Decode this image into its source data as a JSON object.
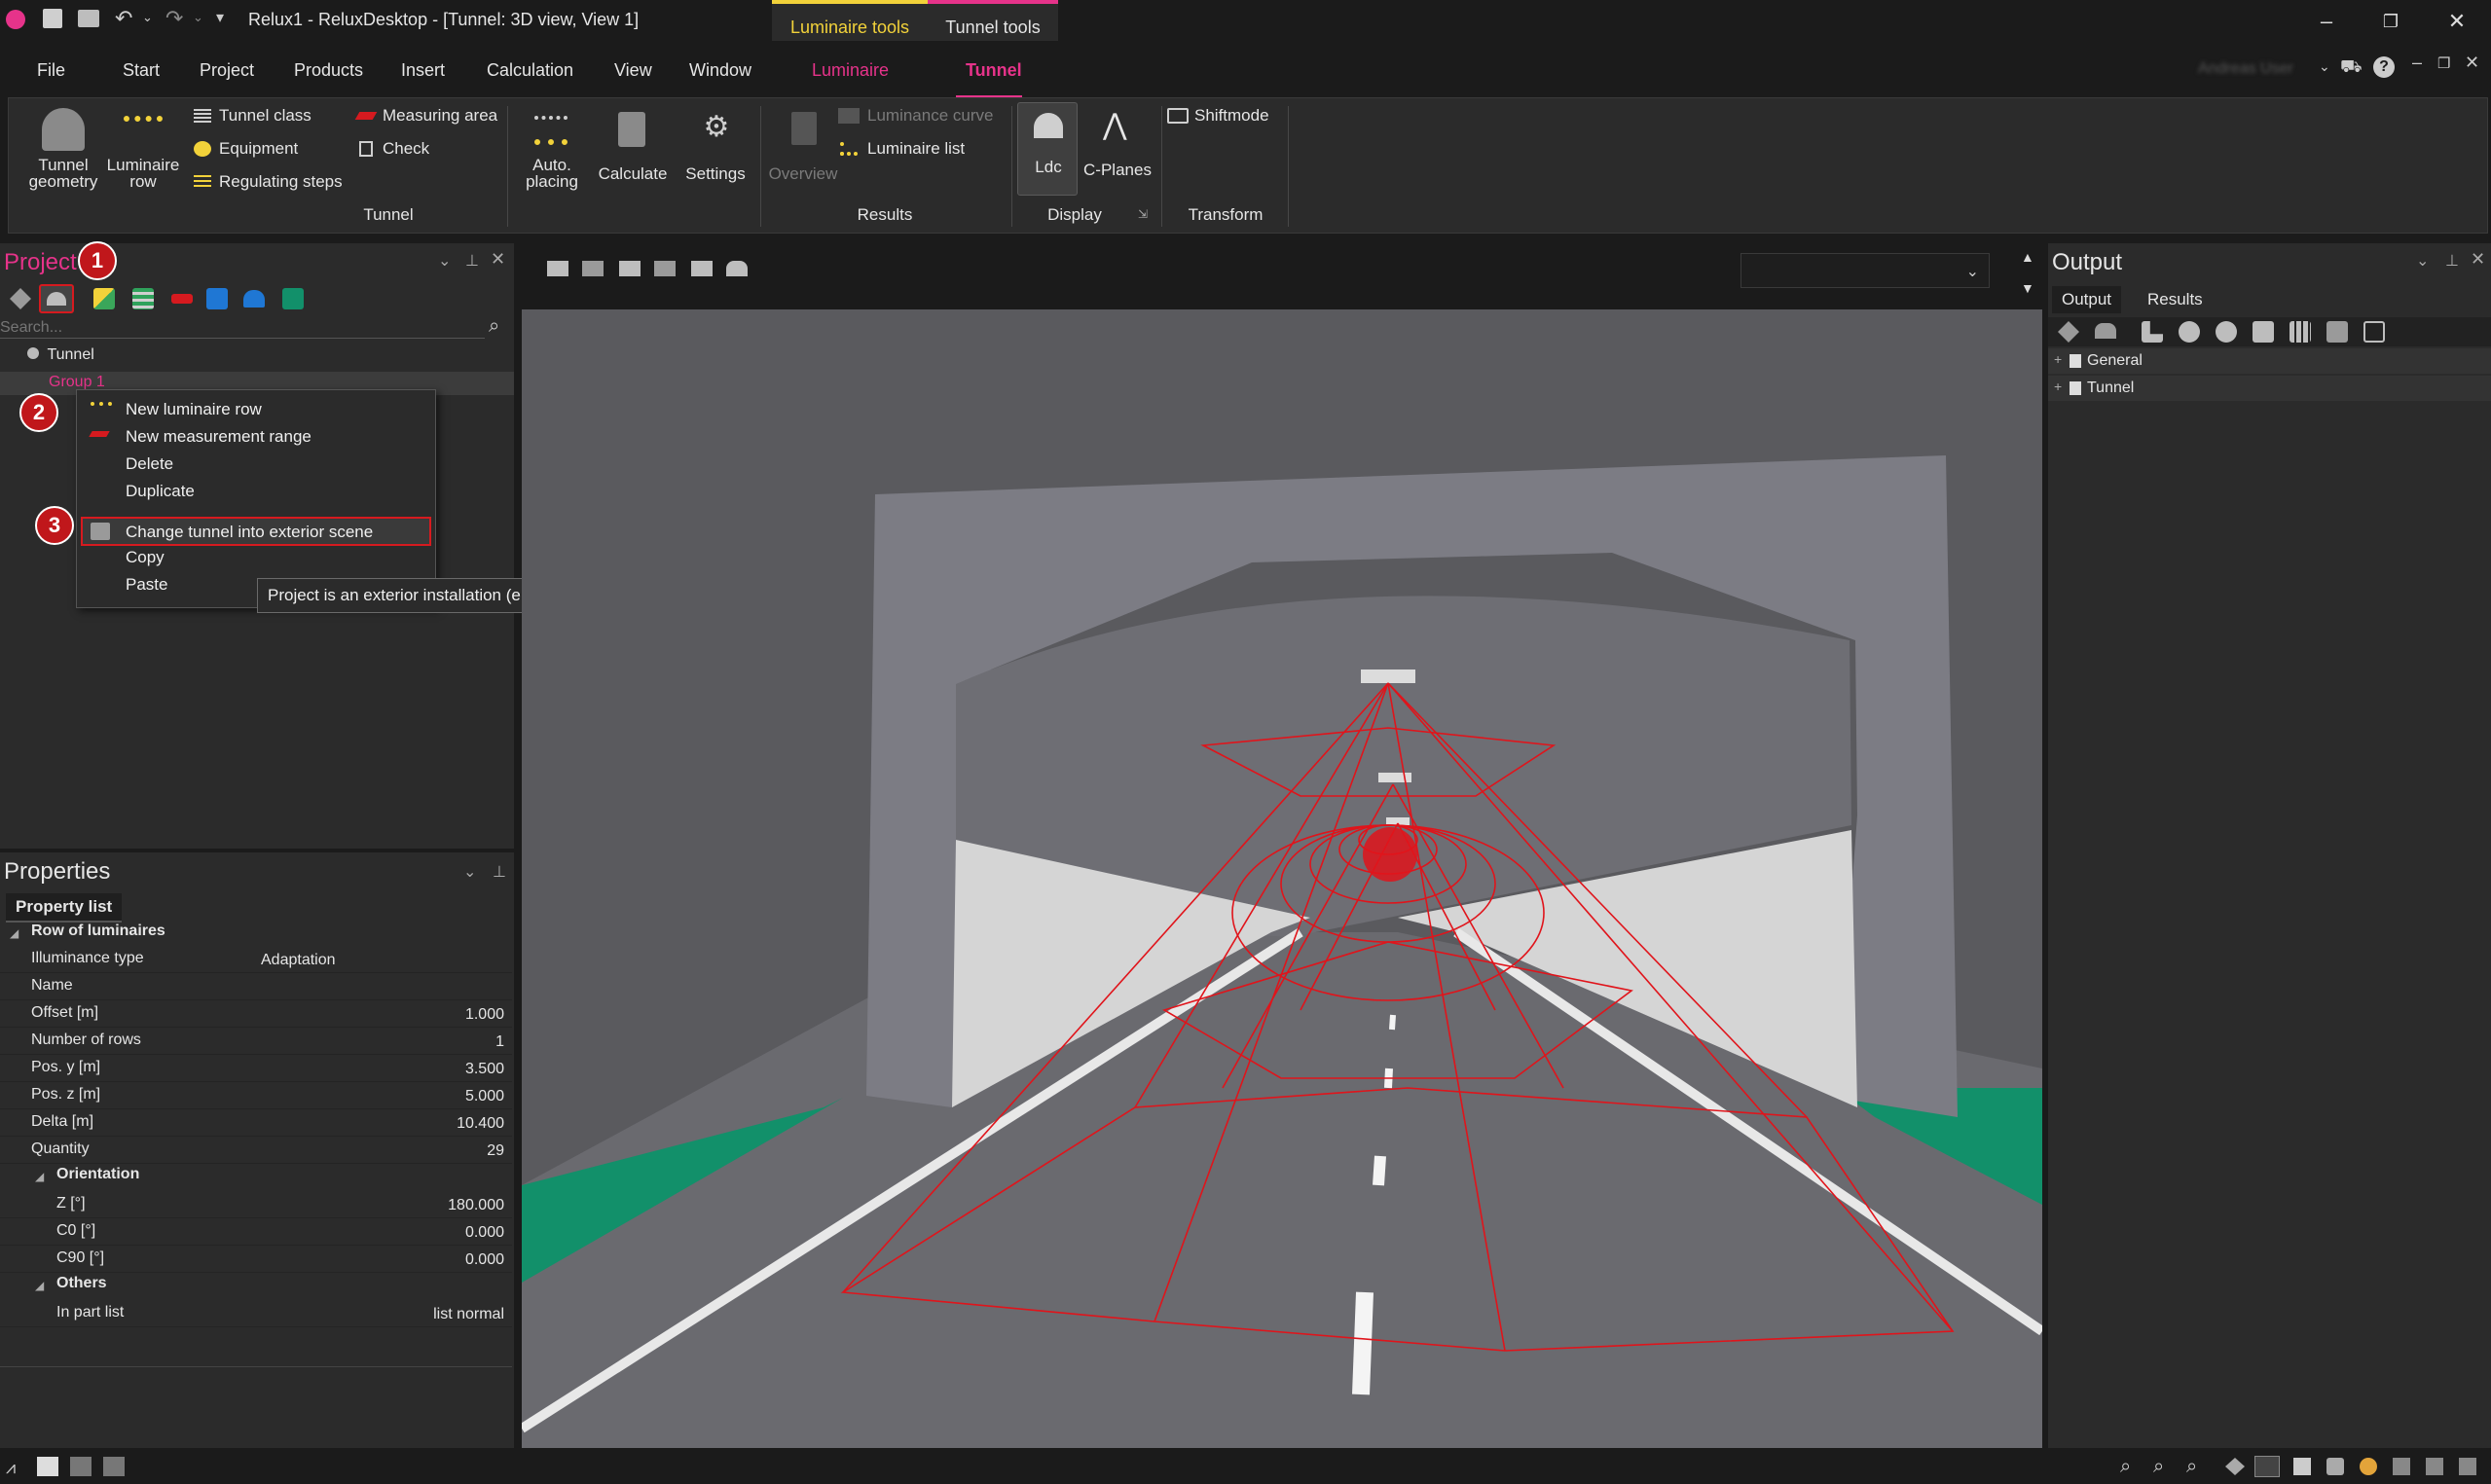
{
  "app": {
    "title": "Relux1 - ReluxDesktop - [Tunnel: 3D view, View 1]",
    "account": "Andreas User"
  },
  "contextual_tabs": {
    "luminaire_tools": "Luminaire tools",
    "tunnel_tools": "Tunnel tools"
  },
  "menu": {
    "items": [
      "File",
      "Start",
      "Project",
      "Products",
      "Insert",
      "Calculation",
      "View",
      "Window",
      "Luminaire",
      "Tunnel"
    ]
  },
  "ribbon": {
    "tunnel_geometry": "Tunnel\ngeometry",
    "luminaire_row": "Luminaire\nrow",
    "tunnel_class": "Tunnel class",
    "equipment": "Equipment",
    "regulating_steps": "Regulating steps",
    "measuring_area": "Measuring area",
    "check": "Check",
    "auto_placing": "Auto.\nplacing",
    "calculate": "Calculate",
    "settings": "Settings",
    "overview": "Overview",
    "luminance_curve": "Luminance curve",
    "luminaire_list": "Luminaire list",
    "ldc": "Ldc",
    "c_planes": "C-Planes",
    "shiftmode": "Shiftmode",
    "groups": {
      "tunnel": "Tunnel",
      "results": "Results",
      "display": "Display",
      "transform": "Transform"
    }
  },
  "project_panel": {
    "title": "Project",
    "search_placeholder": "Search...",
    "tree": {
      "root": "Tunnel",
      "group": "Group 1"
    }
  },
  "context_menu": {
    "items": [
      "New luminaire row",
      "New measurement range",
      "Delete",
      "Duplicate",
      "Change tunnel into exterior scene",
      "Copy",
      "Paste"
    ]
  },
  "tooltip": "Project is an exterior installation (e.g. sports ground, road)",
  "badges": [
    "1",
    "2",
    "3"
  ],
  "properties": {
    "title": "Properties",
    "tab": "Property list",
    "section": "Row of luminaires",
    "rows": [
      {
        "label": "Illuminance type",
        "value": "Adaptation"
      },
      {
        "label": "Name",
        "value": ""
      },
      {
        "label": "Offset [m]",
        "value": "1.000"
      },
      {
        "label": "Number of rows",
        "value": "1"
      },
      {
        "label": "Pos. y  [m]",
        "value": "3.500"
      },
      {
        "label": "Pos. z [m]",
        "value": "5.000"
      },
      {
        "label": "Delta [m]",
        "value": "10.400"
      },
      {
        "label": "Quantity",
        "value": "29"
      }
    ],
    "orientation": {
      "title": "Orientation",
      "rows": [
        {
          "label": "Z [°]",
          "value": "180.000"
        },
        {
          "label": "C0 [°]",
          "value": "0.000"
        },
        {
          "label": "C90 [°]",
          "value": "0.000"
        }
      ]
    },
    "others": {
      "title": "Others",
      "rows": [
        {
          "label": "In part list",
          "value": "list normal"
        }
      ]
    }
  },
  "output_panel": {
    "title": "Output",
    "tabs": [
      "Output",
      "Results"
    ],
    "tree": [
      "General",
      "Tunnel"
    ]
  },
  "colors": {
    "accent_magenta": "#e6338a",
    "accent_yellow": "#f2d23a",
    "highlight_red": "#d61a1f",
    "road_green": "#12906a",
    "tunnel_wall": "#7c7c84",
    "tunnel_inner": "#d5d5d5",
    "road_grey": "#6b6b70",
    "light_lines": "#e0141b"
  }
}
